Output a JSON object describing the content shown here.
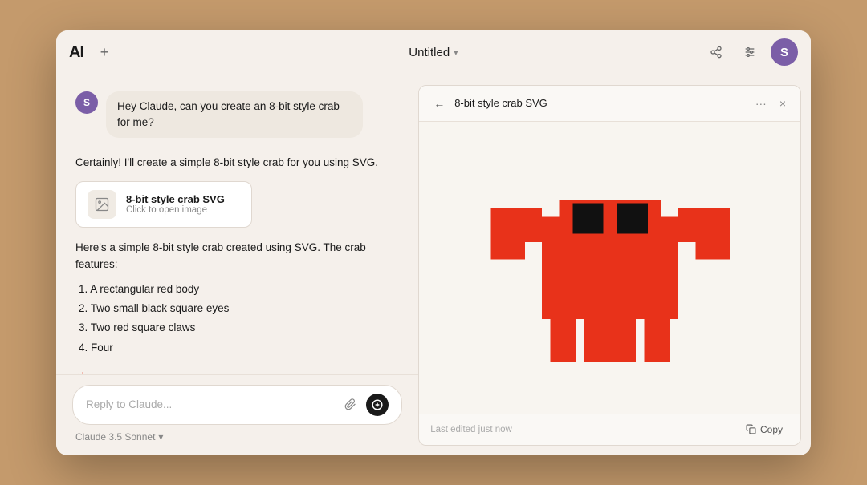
{
  "window": {
    "title": "Untitled",
    "title_chevron": "▾"
  },
  "header": {
    "logo_text": "AI",
    "new_tab_label": "+",
    "share_icon": "share",
    "settings_icon": "sliders",
    "avatar_label": "S"
  },
  "chat": {
    "user_avatar": "S",
    "user_message": "Hey Claude, can you create an 8-bit style crab for me?",
    "assistant_intro": "Certainly! I'll create a simple 8-bit style crab for you using SVG.",
    "artifact_title": "8-bit style crab SVG",
    "artifact_subtitle": "Click to open image",
    "description": "Here's a simple 8-bit style crab created using SVG. The crab features:",
    "list_items": [
      "1. A rectangular red body",
      "2. Two small black square eyes",
      "3. Two red square claws",
      "4. Four"
    ],
    "input_placeholder": "Reply to Claude...",
    "model_selector": "Claude 3.5 Sonnet",
    "model_chevron": "▾"
  },
  "preview": {
    "title": "8-bit style crab SVG",
    "back_icon": "←",
    "menu_icon": "···",
    "close_icon": "×",
    "footer_text": "Last edited just now",
    "copy_label": "Copy"
  }
}
